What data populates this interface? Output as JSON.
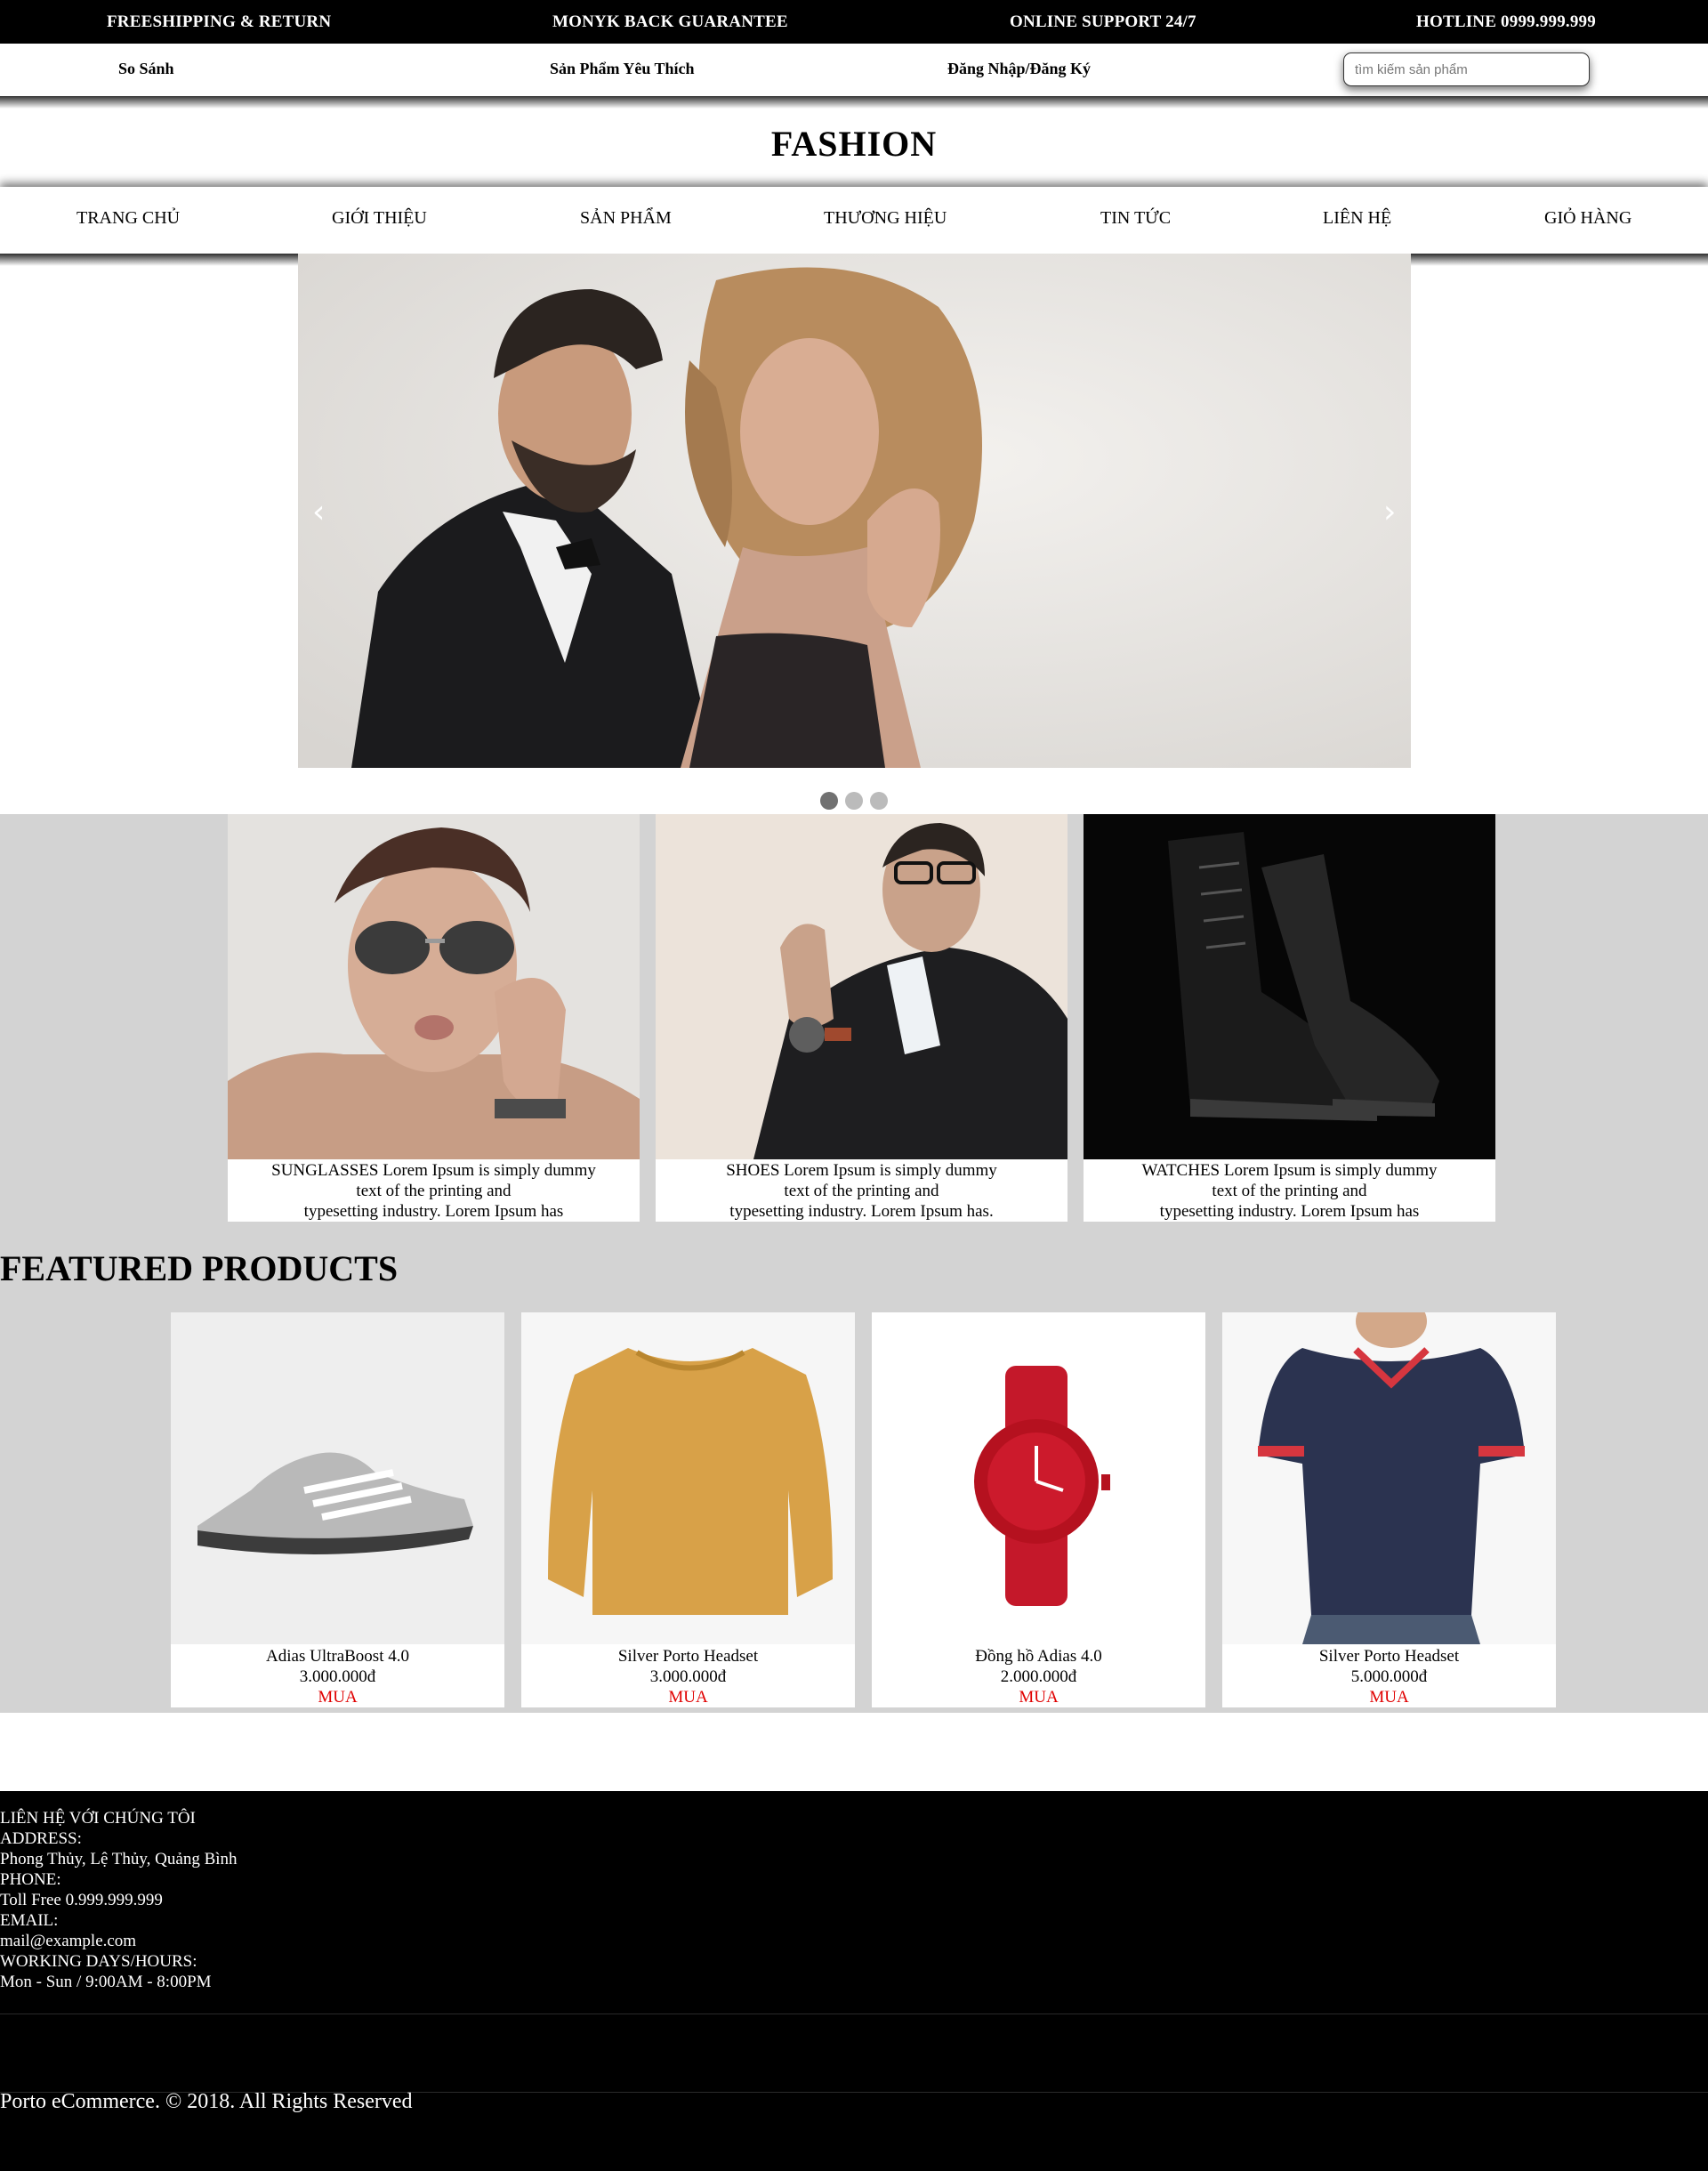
{
  "topbar": {
    "shipping": "FREESHIPPING & RETURN",
    "guarantee": "MONYK BACK GUARANTEE",
    "support": "ONLINE SUPPORT 24/7",
    "hotline": "HOTLINE 0999.999.999"
  },
  "utility": {
    "compare": "So Sánh",
    "favorites": "Sản Phẩm Yêu Thích",
    "login": "Đăng Nhập/Đăng Ký",
    "search_placeholder": "tìm kiếm sản phẩm"
  },
  "brand": "FASHION",
  "nav": [
    "TRANG CHỦ",
    "GIỚI THIỆU",
    "SẢN PHẨM",
    "THƯƠNG HIỆU",
    "TIN TỨC",
    "LIÊN HỆ",
    "GIỎ HÀNG"
  ],
  "slider": {
    "prev": "‹",
    "next": "›",
    "slide_count": 3,
    "active_slide": 1
  },
  "categories": [
    {
      "lines": [
        "SUNGLASSES Lorem Ipsum is simply dummy",
        "text of the printing and",
        "typesetting industry. Lorem Ipsum has"
      ]
    },
    {
      "lines": [
        "SHOES Lorem Ipsum is simply dummy",
        "text of the printing and",
        "typesetting industry. Lorem Ipsum has."
      ]
    },
    {
      "lines": [
        "WATCHES Lorem Ipsum is simply dummy",
        "text of the printing and",
        "typesetting industry. Lorem Ipsum has"
      ]
    }
  ],
  "featured": {
    "title": "FEATURED PRODUCTS",
    "products": [
      {
        "name": "Adias UltraBoost 4.0",
        "price": "3.000.000đ",
        "buy": "MUA"
      },
      {
        "name": "Silver Porto Headset",
        "price": "3.000.000đ",
        "buy": "MUA"
      },
      {
        "name": "Đồng hồ Adias 4.0",
        "price": "2.000.000đ",
        "buy": "MUA"
      },
      {
        "name": "Silver Porto Headset",
        "price": "5.000.000đ",
        "buy": "MUA"
      }
    ]
  },
  "footer": {
    "heading": "LIÊN HỆ VỚI CHÚNG TÔI",
    "address_label": "ADDRESS:",
    "address": "Phong Thủy, Lệ Thủy, Quảng Bình",
    "phone_label": "PHONE:",
    "phone": "Toll Free 0.999.999.999",
    "email_label": "EMAIL:",
    "email": "mail@example.com",
    "hours_label": "WORKING DAYS/HOURS:",
    "hours": "Mon - Sun / 9:00AM - 8:00PM",
    "copyright": "Porto eCommerce. © 2018. All Rights Reserved"
  },
  "colors": {
    "topbar": "#000000",
    "section_bg": "#d3d3d3",
    "buy": "#e00000",
    "footer": "#000000"
  }
}
